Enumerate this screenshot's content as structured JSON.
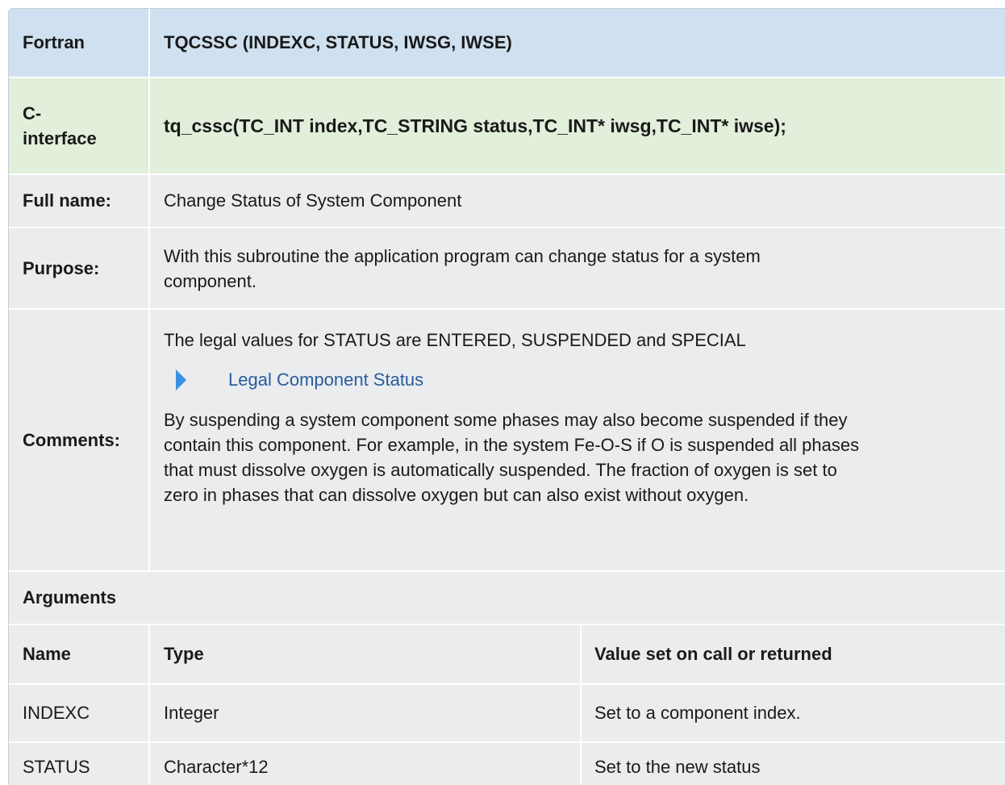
{
  "fortran": {
    "label": "Fortran",
    "signature": "TQCSSC (INDEXC, STATUS, IWSG, IWSE)"
  },
  "c_interface": {
    "label_line1": "C-",
    "label_line2": "interface",
    "signature": "tq_cssc(TC_INT index,TC_STRING status,TC_INT* iwsg,TC_INT* iwse);"
  },
  "full_name": {
    "label": "Full name:",
    "value": "Change Status of System Component"
  },
  "purpose": {
    "label": "Purpose:",
    "line1": "With this subroutine the application program can change status for a system",
    "line2": "component."
  },
  "comments": {
    "label": "Comments:",
    "intro": "The legal values for STATUS are ENTERED, SUSPENDED and SPECIAL",
    "link": "Legal Component Status",
    "para_lines": [
      "By suspending a system component some phases may also become suspended if they",
      "contain this component. For example, in the system Fe-O-S if O is suspended all phases",
      "that must dissolve oxygen is automatically suspended. The fraction of oxygen is set to",
      "zero in phases that can dissolve oxygen but can also exist without oxygen."
    ]
  },
  "arguments": {
    "title": "Arguments",
    "columns": [
      "Name",
      "Type",
      "Value set on call or returned"
    ],
    "rows": [
      [
        "INDEXC",
        "Integer",
        "Set to a component index."
      ],
      [
        "STATUS",
        "Character*12",
        "Set to the new status"
      ]
    ]
  },
  "colors": {
    "header_bg": "#cfe1f0",
    "c_bg": "#e2efda",
    "grey_bg": "#eaecee",
    "link": "#2b5c9e",
    "arrow": "#3a8fe0"
  }
}
